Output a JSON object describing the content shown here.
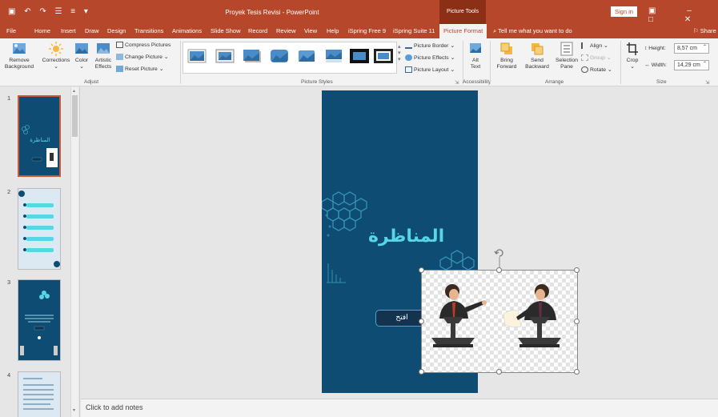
{
  "titlebar": {
    "quick_access": "▣ ↶ ↷ ☰ ≡ ▾",
    "doc_title": "Proyek Tesis Revisi - PowerPoint",
    "context_tab": "Picture Tools",
    "sign_in": "Sign in",
    "window_buttons": "▣ – □ ✕"
  },
  "tabs": {
    "items": [
      "File",
      "Home",
      "Insert",
      "Draw",
      "Design",
      "Transitions",
      "Animations",
      "Slide Show",
      "Record",
      "Review",
      "View",
      "Help",
      "iSpring Free 9",
      "iSpring Suite 11",
      "Picture Format"
    ],
    "tell_me": "⌕  Tell me what you want to do",
    "share": "⚐ Share"
  },
  "ribbon": {
    "adjust": {
      "remove_background": "Remove Background",
      "corrections": "Corrections",
      "color": "Color",
      "artistic_effects": "Artistic Effects",
      "compress": "Compress Pictures",
      "change_picture": "Change Picture",
      "reset_picture": "Reset Picture",
      "label": "Adjust"
    },
    "styles": {
      "label": "Picture Styles",
      "border": "Picture Border",
      "effects": "Picture Effects",
      "layout": "Picture Layout"
    },
    "accessibility": {
      "alt_text": "Alt Text",
      "label": "Accessibility"
    },
    "arrange": {
      "bring_forward": "Bring Forward",
      "send_backward": "Send Backward",
      "selection_pane": "Selection Pane",
      "align": "Align",
      "group": "Group",
      "rotate": "Rotate",
      "label": "Arrange"
    },
    "size": {
      "crop": "Crop",
      "height_label": "Height:",
      "height_value": "8,57 cm",
      "width_label": "Width:",
      "width_value": "14,29 cm",
      "label": "Size"
    }
  },
  "thumbnails": {
    "numbers": [
      "1",
      "2",
      "3",
      "4"
    ],
    "slide1_title": "المناظرة"
  },
  "slide": {
    "title": "المناظرة",
    "button_label": "افتح"
  },
  "notes": {
    "placeholder": "Click to add notes"
  },
  "colors": {
    "accent": "#b7472a",
    "slide_bg": "#0e4c74",
    "slide_title": "#56d6e6"
  }
}
